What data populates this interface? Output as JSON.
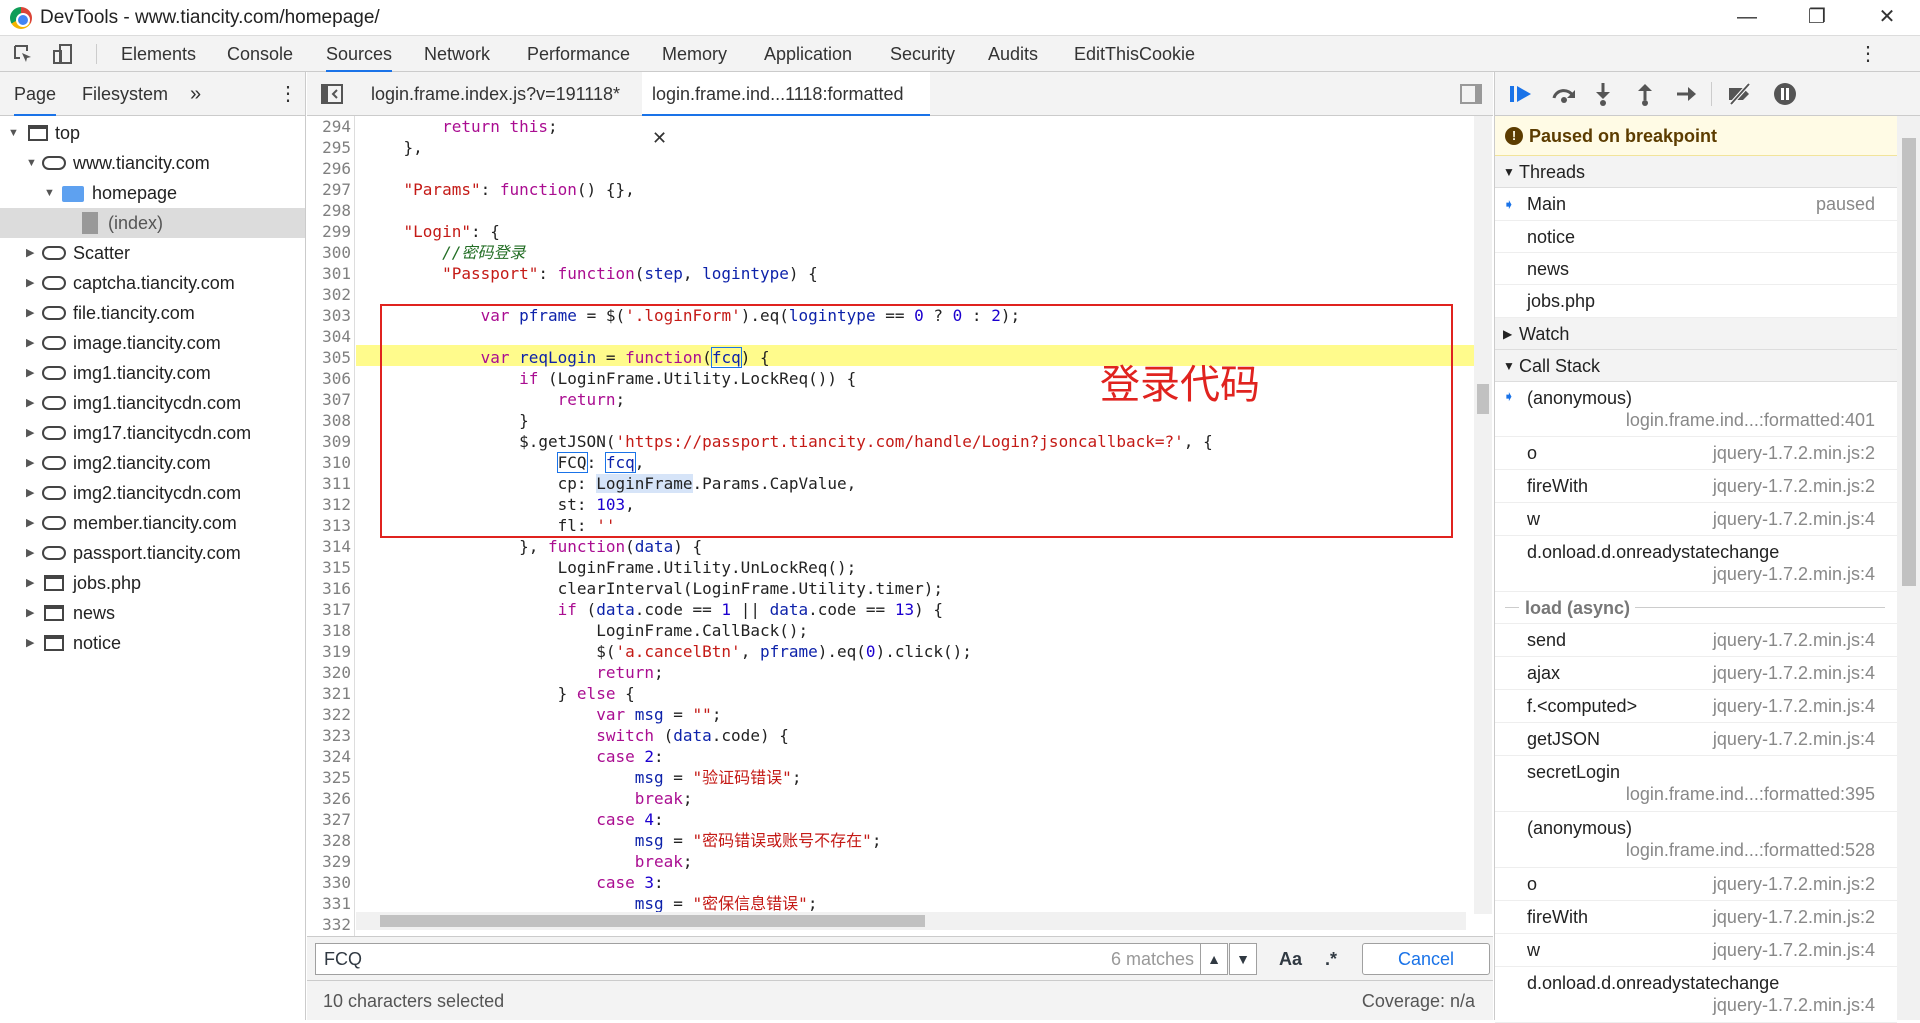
{
  "window": {
    "title": "DevTools - www.tiancity.com/homepage/",
    "minimize": "—",
    "maximize": "❐",
    "close": "✕"
  },
  "panels": [
    "Elements",
    "Console",
    "Sources",
    "Network",
    "Performance",
    "Memory",
    "Application",
    "Security",
    "Audits",
    "EditThisCookie"
  ],
  "active_panel": "Sources",
  "navigator": {
    "tabs": [
      "Page",
      "Filesystem"
    ],
    "more": "»",
    "menu": "⋮",
    "tree": [
      "top",
      "www.tiancity.com",
      "homepage",
      "(index)",
      "Scatter",
      "captcha.tiancity.com",
      "file.tiancity.com",
      "image.tiancity.com",
      "img1.tiancity.com",
      "img1.tiancitycdn.com",
      "img17.tiancitycdn.com",
      "img2.tiancity.com",
      "img2.tiancitycdn.com",
      "member.tiancity.com",
      "passport.tiancity.com",
      "jobs.php",
      "news",
      "notice"
    ]
  },
  "editor": {
    "tabs": [
      "login.frame.index.js?v=191118*",
      "login.frame.ind...1118:formatted"
    ],
    "close_glyph": "✕",
    "line_numbers": [
      "294",
      "295",
      "296",
      "297",
      "298",
      "299",
      "300",
      "301",
      "302",
      "303",
      "304",
      "305",
      "306",
      "307",
      "308",
      "309",
      "310",
      "311",
      "312",
      "313",
      "314",
      "315",
      "316",
      "317",
      "318",
      "319",
      "320",
      "321",
      "322",
      "323",
      "324",
      "325",
      "326",
      "327",
      "328",
      "329",
      "330",
      "331",
      "332"
    ],
    "annotation": "登录代码"
  },
  "search": {
    "value": "FCQ",
    "matches": "6 matches",
    "case": "Aa",
    "regex": ".*",
    "cancel": "Cancel"
  },
  "status": {
    "selection": "10 characters selected",
    "coverage": "Coverage: n/a"
  },
  "debugger": {
    "paused": "Paused on breakpoint",
    "threads_label": "Threads",
    "threads": [
      {
        "name": "Main",
        "status": "paused"
      },
      {
        "name": "notice",
        "status": ""
      },
      {
        "name": "news",
        "status": ""
      },
      {
        "name": "jobs.php",
        "status": ""
      }
    ],
    "watch_label": "Watch",
    "callstack_label": "Call Stack",
    "async_label": "load (async)"
  },
  "accent_color": "#1a73e8",
  "annotation_color": "#e0231f"
}
